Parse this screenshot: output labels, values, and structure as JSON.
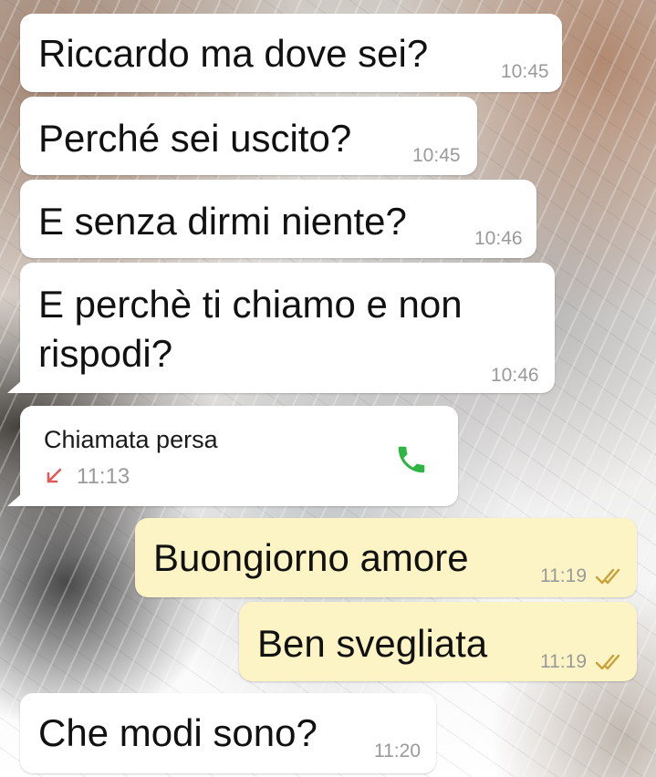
{
  "messages": [
    {
      "text": "Riccardo ma dove sei?",
      "time": "10:45"
    },
    {
      "text": "Perché sei uscito?",
      "time": "10:45"
    },
    {
      "text": "E senza dirmi niente?",
      "time": "10:46"
    },
    {
      "line1": "E perchè ti chiamo e non",
      "line2": "rispodi?",
      "time": "10:46"
    },
    {
      "call_label": "Chiamata persa",
      "time": "11:13",
      "icon": "phone-icon",
      "arrow_icon": "missed-call-arrow-icon"
    },
    {
      "text": "Buongiorno amore",
      "time": "11:19",
      "status": "read-ticks-icon"
    },
    {
      "text": "Ben svegliata",
      "time": "11:19",
      "status": "read-ticks-icon"
    },
    {
      "text": "Che modi sono?",
      "time": "11:20"
    }
  ],
  "colors": {
    "incoming": "#ffffff",
    "outgoing": "#fcf4c4",
    "timestamp": "#9a9a9a",
    "missed": "#e05a5a",
    "phone": "#2fb543",
    "ticks": "#c9a13a"
  }
}
